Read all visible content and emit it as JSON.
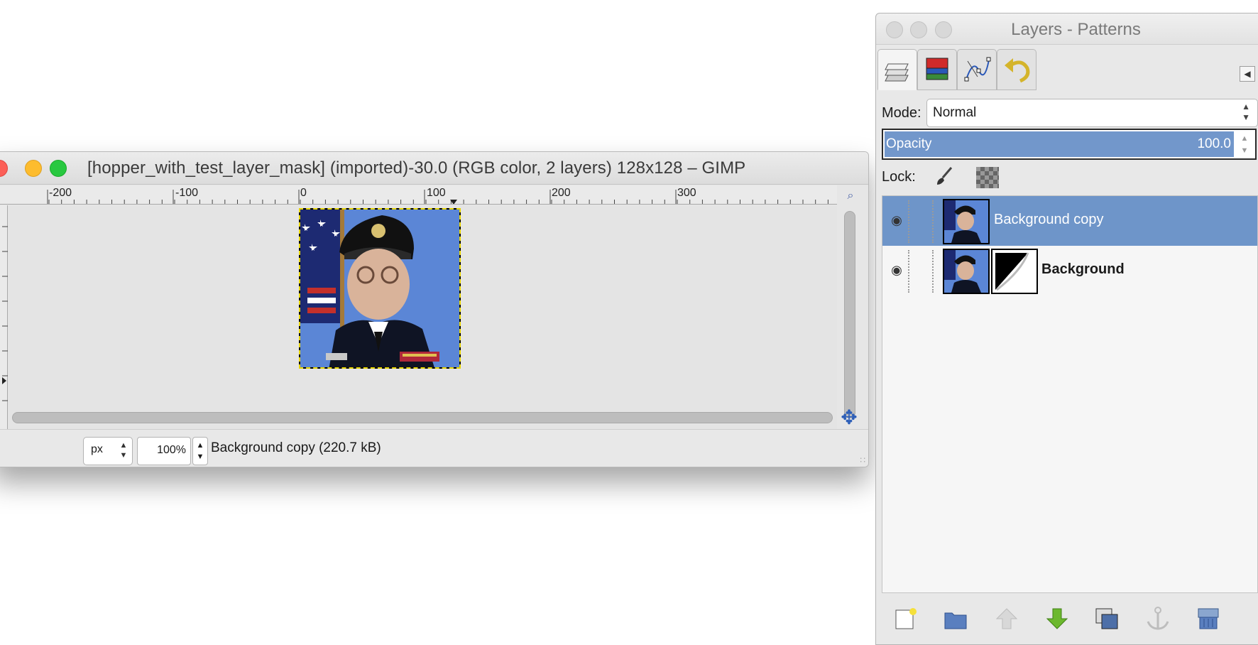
{
  "image_window": {
    "title": "[hopper_with_test_layer_mask] (imported)-30.0 (RGB color, 2 layers) 128x128 – GIMP",
    "ruler_labels": [
      "-200",
      "-100",
      "0",
      "100",
      "200",
      "300"
    ],
    "unit": "px",
    "zoom": "100%",
    "status": "Background copy (220.7 kB)"
  },
  "dock": {
    "title": "Layers - Patterns",
    "tabs": [
      {
        "name": "layers-icon"
      },
      {
        "name": "channels-icon"
      },
      {
        "name": "paths-icon"
      },
      {
        "name": "undo-history-icon"
      }
    ],
    "mode_label": "Mode:",
    "mode_value": "Normal",
    "opacity_label": "Opacity",
    "opacity_value": "100.0",
    "opacity_fraction": 1.0,
    "lock_label": "Lock:",
    "layers": [
      {
        "name": "Background copy",
        "selected": true,
        "has_mask": false
      },
      {
        "name": "Background",
        "selected": false,
        "has_mask": true
      }
    ],
    "bottom_buttons": [
      "new-layer-icon",
      "new-layer-group-icon",
      "raise-layer-icon",
      "lower-layer-icon",
      "duplicate-layer-icon",
      "anchor-layer-icon",
      "delete-layer-icon"
    ]
  },
  "colors": {
    "selection": "#6e95c9",
    "close": "#fc5f57",
    "minimize": "#fdbc2e",
    "zoom": "#28c840"
  }
}
